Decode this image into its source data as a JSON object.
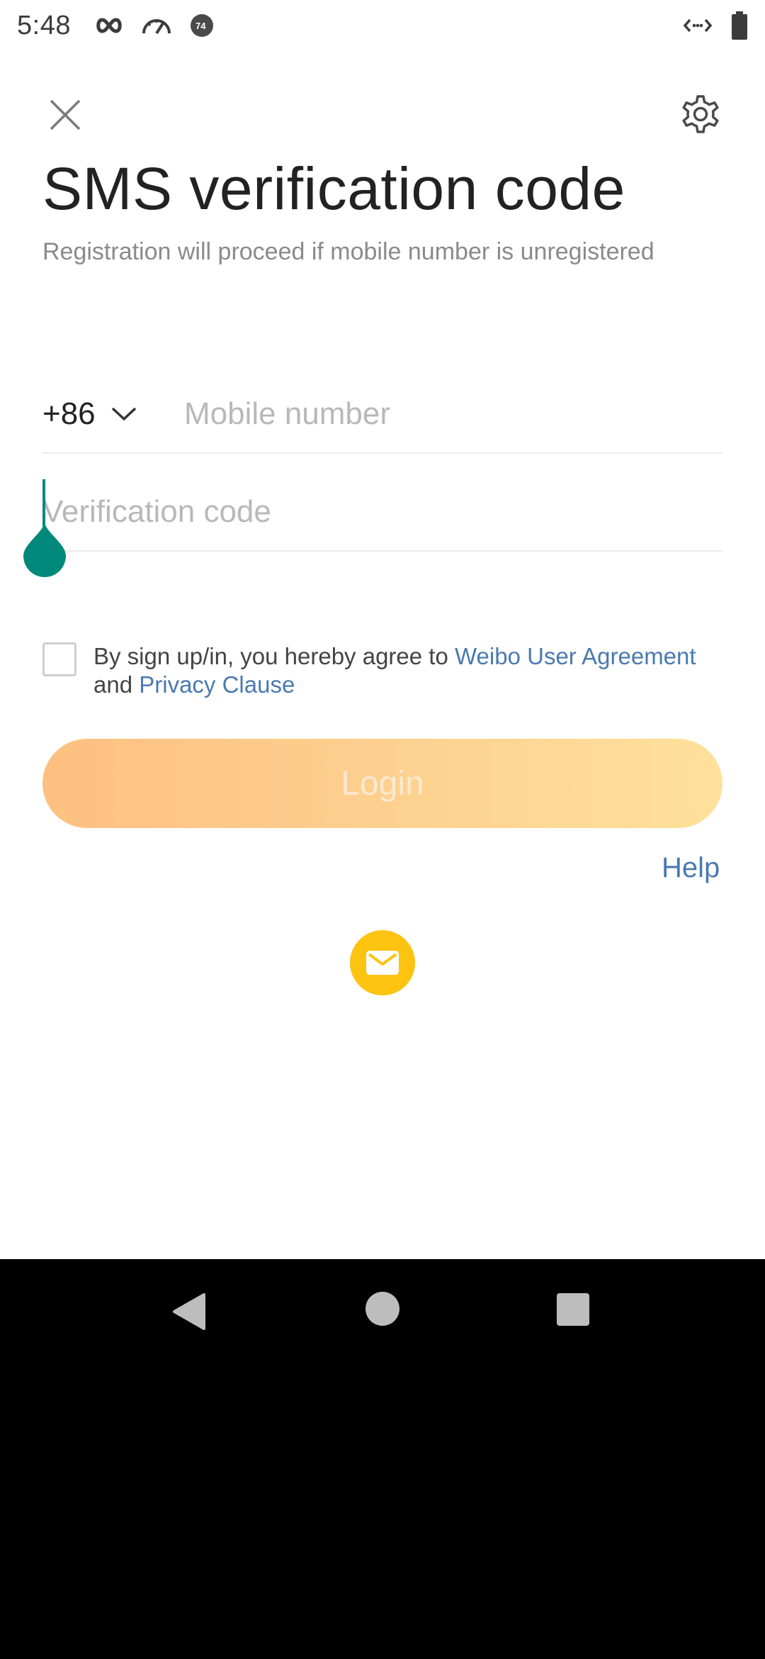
{
  "status_bar": {
    "time": "5:48",
    "icons": [
      "infinity-icon",
      "speedometer-icon",
      "notification-badge-icon",
      "data-transfer-icon",
      "battery-icon"
    ],
    "badge_number": "74"
  },
  "header": {
    "close_icon": "close-icon",
    "settings_icon": "gear-icon"
  },
  "title": "SMS verification code",
  "subtitle": "Registration will proceed if mobile number is unregistered",
  "phone": {
    "country_code": "+86",
    "placeholder": "Mobile number",
    "value": ""
  },
  "code": {
    "placeholder": "Verification code",
    "value": ""
  },
  "agreement": {
    "checked": false,
    "prefix": "By sign up/in, you hereby agree to ",
    "link1": "Weibo User Agreement",
    "middle": "and ",
    "link2": "Privacy Clause"
  },
  "login_label": "Login",
  "help_label": "Help",
  "alt_login_icon": "mail-icon",
  "colors": {
    "accent_link": "#4a7ab0",
    "login_gradient_start": "#fdc081",
    "login_gradient_end": "#fee19b",
    "mail_button": "#fcc311",
    "cursor": "#00897b"
  },
  "nav_bar": {
    "icons": [
      "back-icon",
      "home-icon",
      "recents-icon"
    ]
  }
}
